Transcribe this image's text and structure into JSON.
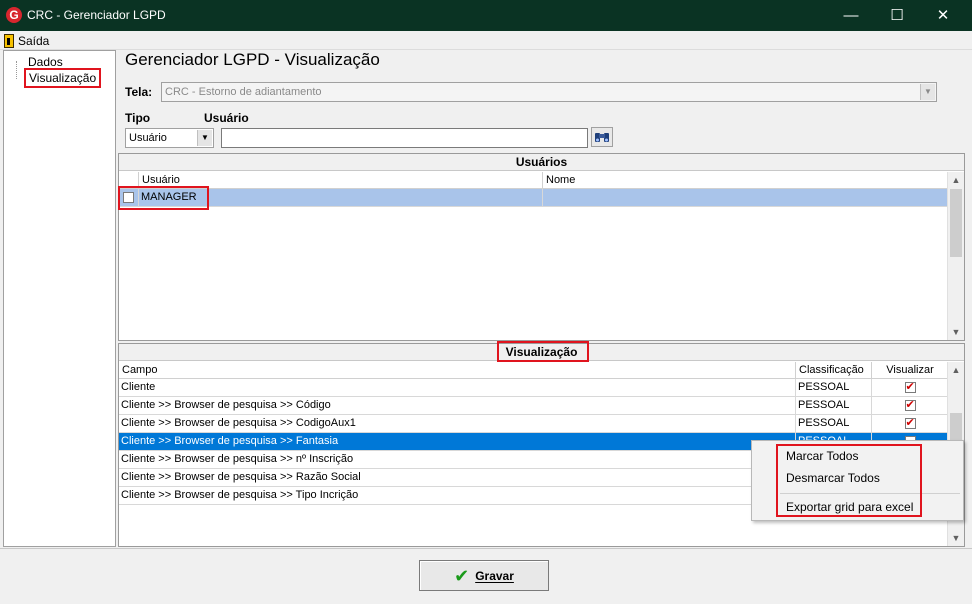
{
  "window": {
    "title": "CRC - Gerenciador LGPD",
    "app_icon": "G"
  },
  "window_controls": {
    "minimize": "—",
    "maximize": "☐",
    "close": "✕"
  },
  "menu": {
    "exit_label": "Saída"
  },
  "tree": {
    "items": [
      "Dados",
      "Visualização"
    ]
  },
  "page": {
    "heading": "Gerenciador LGPD - Visualização"
  },
  "filters": {
    "tela_label": "Tela:",
    "tela_value": "CRC - Estorno de adiantamento",
    "tipo_label": "Tipo",
    "tipo_value": "Usuário",
    "usuario_label": "Usuário",
    "usuario_value": ""
  },
  "users_panel": {
    "title": "Usuários",
    "columns": [
      "Usuário",
      "Nome"
    ],
    "rows": [
      {
        "user": "MANAGER",
        "name": "",
        "checked": false
      }
    ]
  },
  "view_panel": {
    "title": "Visualização",
    "columns": [
      "Campo",
      "Classificação",
      "Visualizar"
    ],
    "rows": [
      {
        "campo": "Cliente",
        "classificacao": "PESSOAL",
        "visualizar": true
      },
      {
        "campo": "Cliente >> Browser de pesquisa >> Código",
        "classificacao": "PESSOAL",
        "visualizar": true
      },
      {
        "campo": "Cliente >> Browser de pesquisa >> CodigoAux1",
        "classificacao": "PESSOAL",
        "visualizar": true
      },
      {
        "campo": "Cliente >> Browser de pesquisa >> Fantasia",
        "classificacao": "PESSOAL",
        "visualizar": false
      },
      {
        "campo": "Cliente >> Browser de pesquisa >> nº Inscrição",
        "classificacao": "",
        "visualizar": false
      },
      {
        "campo": "Cliente >> Browser de pesquisa >> Razão Social",
        "classificacao": "",
        "visualizar": false
      },
      {
        "campo": "Cliente >> Browser de pesquisa >> Tipo Incrição",
        "classificacao": "",
        "visualizar": false
      }
    ]
  },
  "context_menu": {
    "items": [
      "Marcar Todos",
      "Desmarcar Todos",
      "Exportar grid para excel"
    ]
  },
  "footer": {
    "save_label": "Gravar"
  },
  "colors": {
    "titlebar": "#0a3323",
    "highlight": "#e0141e",
    "selection": "#0078d7",
    "check": "#d00000"
  }
}
